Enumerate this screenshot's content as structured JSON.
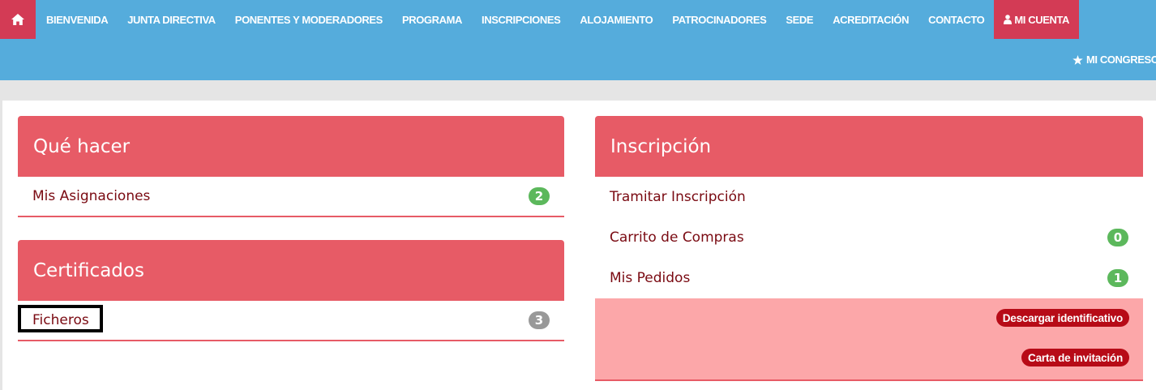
{
  "nav": {
    "home_icon": "home-icon",
    "items": [
      "BIENVENIDA",
      "JUNTA DIRECTIVA",
      "PONENTES Y MODERADORES",
      "PROGRAMA",
      "INSCRIPCIONES",
      "ALOJAMIENTO",
      "PATROCINADORES",
      "SEDE",
      "ACREDITACIÓN",
      "CONTACTO"
    ],
    "account_label": "MI CUENTA",
    "account_icon": "user-icon",
    "congress_label": "MI CONGRESO",
    "congress_icon": "star-icon"
  },
  "que_hacer": {
    "title": "Qué hacer",
    "rows": [
      {
        "label": "Mis Asignaciones",
        "badge": "2"
      }
    ]
  },
  "certificados": {
    "title": "Certificados",
    "rows": [
      {
        "label": "Ficheros",
        "badge": "3"
      }
    ]
  },
  "inscripcion": {
    "title": "Inscripción",
    "rows": [
      {
        "label": "Tramitar Inscripción"
      },
      {
        "label": "Carrito de Compras",
        "badge": "0"
      },
      {
        "label": "Mis Pedidos",
        "badge": "1"
      }
    ],
    "actions": [
      "Descargar identificativo",
      "Carta de invitación"
    ]
  },
  "colors": {
    "nav_bg": "#55acdc",
    "accent_dark": "#d33b55",
    "panel_header": "#e75b66",
    "badge_green": "#5cb85c",
    "badge_gray": "#999999",
    "action_bg": "#fca7a9",
    "pill_bg": "#b70b17",
    "link_text": "#7a0a12"
  }
}
